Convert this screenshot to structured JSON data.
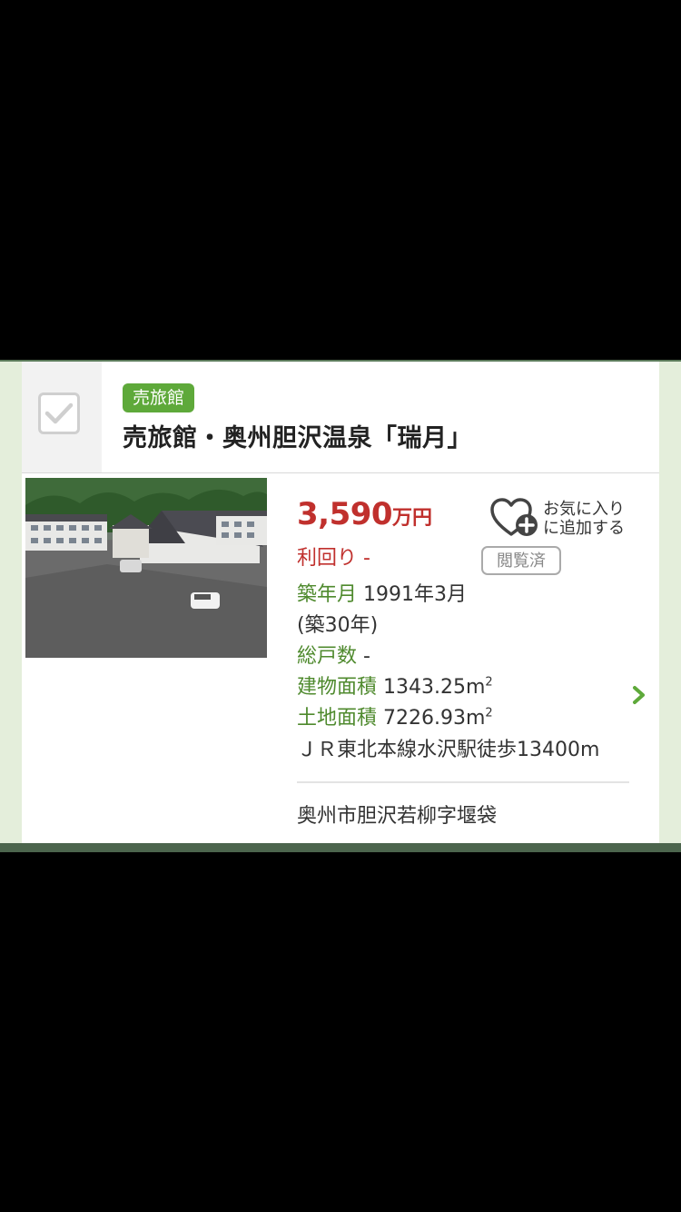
{
  "listing": {
    "tag": "売旅館",
    "title": "売旅館・奥州胆沢温泉「瑞月」",
    "price_number": "3,590",
    "price_unit": "万円",
    "yield_label": "利回り",
    "yield_value": "-",
    "favorite_line1": "お気に入り",
    "favorite_line2": "に追加する",
    "viewed_badge": "閲覧済",
    "built_label": "築年月",
    "built_value": "1991年3月",
    "built_age": "(築30年)",
    "units_label": "総戸数",
    "units_value": "-",
    "building_area_label": "建物面積",
    "building_area_value": "1343.25m",
    "land_area_label": "土地面積",
    "land_area_value": "7226.93m",
    "area_superscript": "2",
    "access": "ＪＲ東北本線水沢駅徒歩13400m",
    "address": "奥州市胆沢若柳字堰袋"
  },
  "colors": {
    "accent_green": "#5ea93a",
    "label_green": "#4f8a2e",
    "price_red": "#c0302d",
    "band_bg": "#e4eedb"
  },
  "icons": [
    "checkbox-icon",
    "heart-plus-icon",
    "chevron-right-icon"
  ]
}
